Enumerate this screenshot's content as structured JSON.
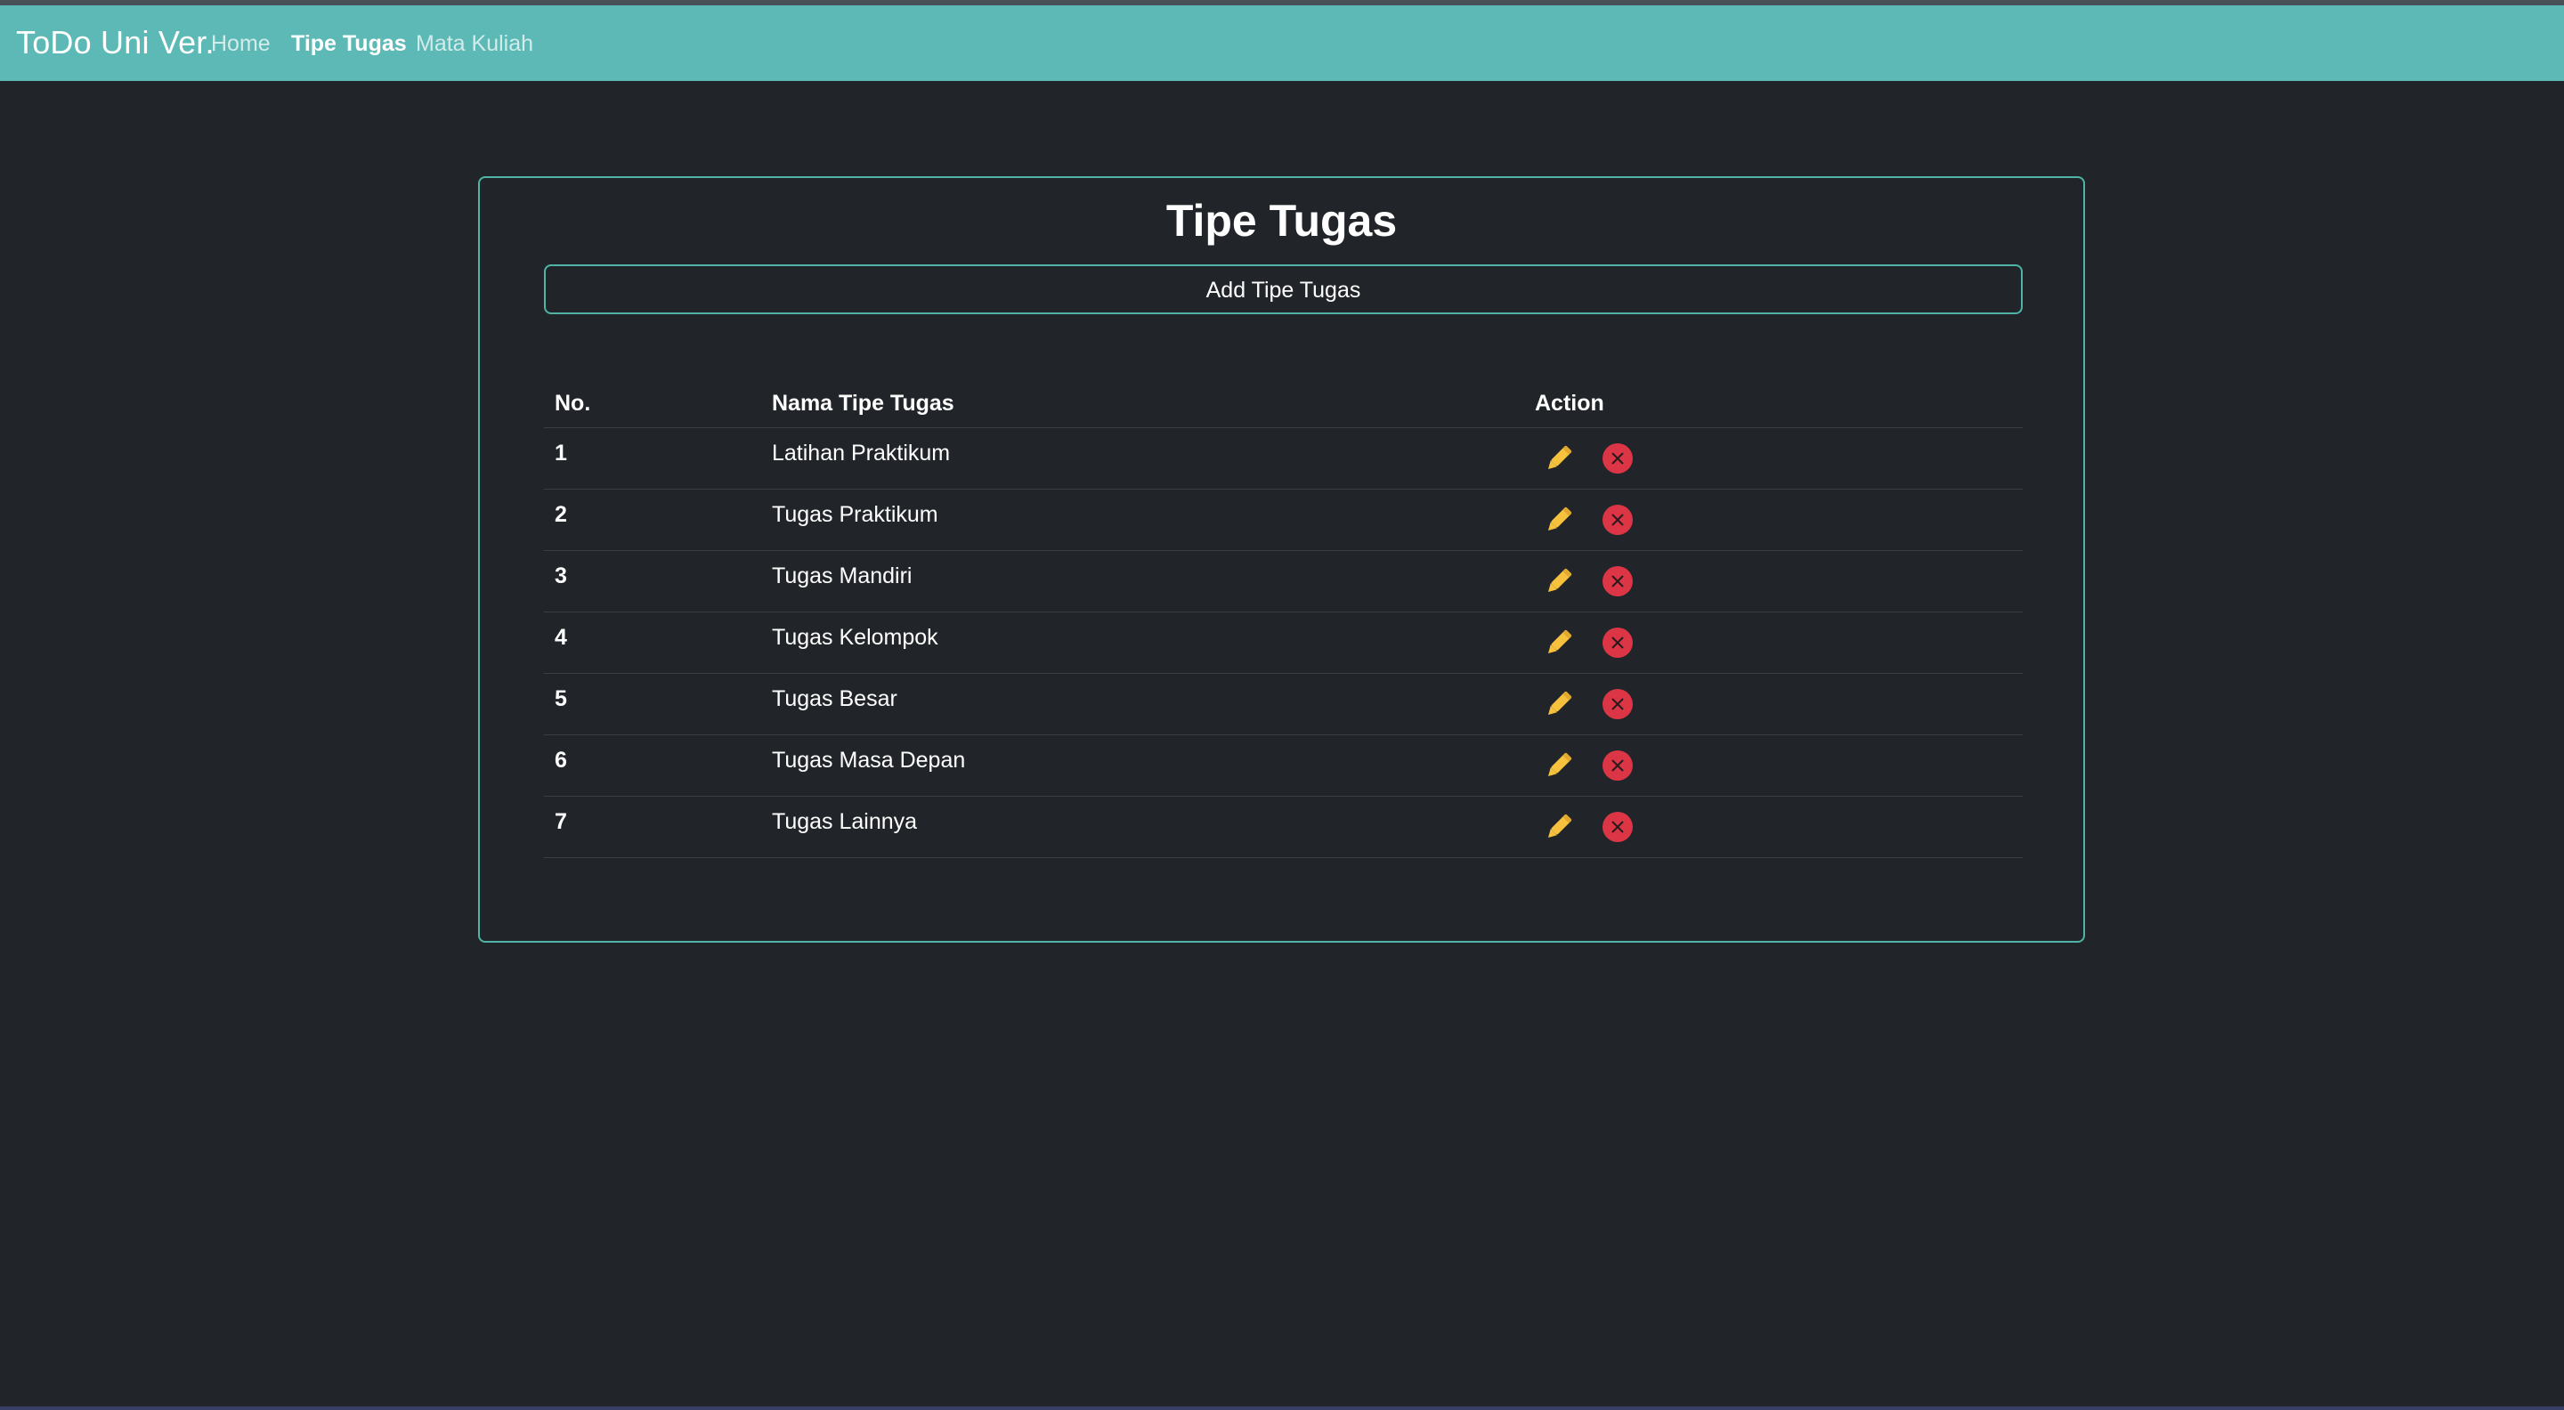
{
  "navbar": {
    "brand": "ToDo Uni Ver.",
    "links": [
      {
        "label": "Home",
        "active": false
      },
      {
        "label": "Tipe Tugas",
        "active": true
      },
      {
        "label": "Mata Kuliah",
        "active": false
      }
    ],
    "color": "#5cb9b5"
  },
  "page": {
    "title": "Tipe Tugas",
    "add_button_label": "Add Tipe Tugas"
  },
  "table": {
    "headers": {
      "no": "No.",
      "name": "Nama Tipe Tugas",
      "action": "Action"
    },
    "rows": [
      {
        "no": "1",
        "name": "Latihan Praktikum"
      },
      {
        "no": "2",
        "name": "Tugas Praktikum"
      },
      {
        "no": "3",
        "name": "Tugas Mandiri"
      },
      {
        "no": "4",
        "name": "Tugas Kelompok"
      },
      {
        "no": "5",
        "name": "Tugas Besar"
      },
      {
        "no": "6",
        "name": "Tugas Masa Depan"
      },
      {
        "no": "7",
        "name": "Tugas Lainnya"
      }
    ],
    "action_icons": {
      "edit": "pencil-icon",
      "delete": "x-circle-icon"
    },
    "edit_color": "#f6c23e",
    "delete_color": "#dc3545"
  }
}
